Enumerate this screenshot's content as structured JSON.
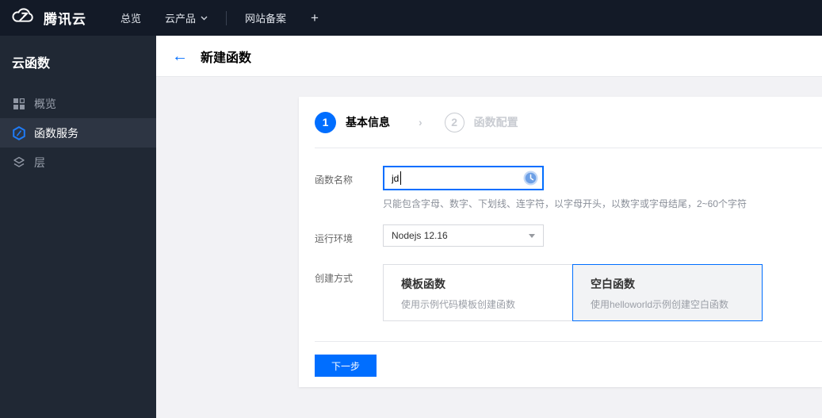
{
  "topbar": {
    "brand_label": "腾讯云",
    "nav": [
      {
        "label": "总览"
      },
      {
        "label": "云产品",
        "has_dropdown": true
      },
      {
        "label": "网站备案"
      }
    ],
    "plus_label": "+"
  },
  "sidebar": {
    "title": "云函数",
    "items": [
      {
        "label": "概览",
        "icon": "grid-icon",
        "active": false
      },
      {
        "label": "函数服务",
        "icon": "function-service-icon",
        "active": true
      },
      {
        "label": "层",
        "icon": "layers-icon",
        "active": false
      }
    ]
  },
  "header": {
    "back_icon": "←",
    "title": "新建函数"
  },
  "wizard": {
    "steps": [
      {
        "number": "1",
        "label": "基本信息",
        "active": true
      },
      {
        "number": "2",
        "label": "函数配置",
        "active": false
      }
    ],
    "separator": "›"
  },
  "form": {
    "name": {
      "label": "函数名称",
      "value": "jd",
      "help": "只能包含字母、数字、下划线、连字符，以字母开头，以数字或字母结尾，2~60个字符",
      "trailing_icon": "clock-icon"
    },
    "runtime": {
      "label": "运行环境",
      "value": "Nodejs 12.16"
    },
    "method": {
      "label": "创建方式",
      "options": [
        {
          "title": "模板函数",
          "desc": "使用示例代码模板创建函数",
          "selected": false
        },
        {
          "title": "空白函数",
          "desc": "使用helloworld示例创建空白函数",
          "selected": true
        }
      ]
    }
  },
  "actions": {
    "next_label": "下一步"
  },
  "colors": {
    "accent": "#006eff",
    "topbar_bg": "#131a27",
    "sidebar_bg": "#202834",
    "sidebar_active_bg": "#2d3543"
  }
}
